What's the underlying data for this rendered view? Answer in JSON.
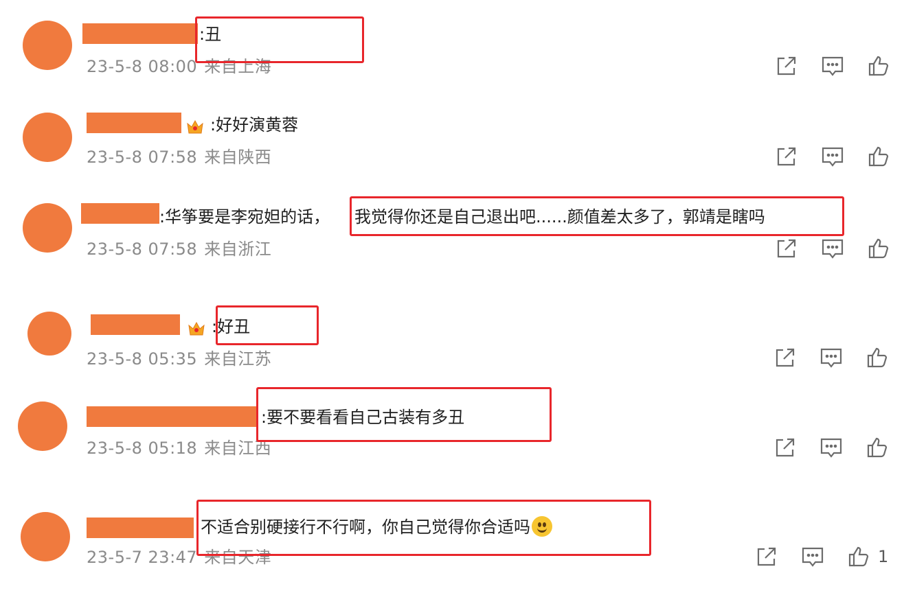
{
  "colors": {
    "avatar": "#f07a3e",
    "highlight_box": "#e8262b",
    "meta_text": "#8a8a8a",
    "content_text": "#1f1f1f",
    "icon_stroke": "#6b6b6b"
  },
  "comments": [
    {
      "text": ":丑",
      "time": "23-5-8 08:00",
      "location": "来自上海",
      "has_badge": false,
      "like_count": ""
    },
    {
      "text": ":好好演黄蓉",
      "time": "23-5-8 07:58",
      "location": "来自陕西",
      "has_badge": true,
      "badge_icon": "crown-badge-icon",
      "like_count": ""
    },
    {
      "text_prefix": ":华筝要是李宛妲的话，",
      "text": "我觉得你还是自己退出吧......颜值差太多了，郭靖是瞎吗",
      "time": "23-5-8 07:58",
      "location": "来自浙江",
      "has_badge": false,
      "like_count": ""
    },
    {
      "text": ":好丑",
      "time": "23-5-8 05:35",
      "location": "来自江苏",
      "has_badge": true,
      "badge_icon": "crown-badge-icon",
      "like_count": ""
    },
    {
      "text": ":要不要看看自己古装有多丑",
      "time": "23-5-8 05:18",
      "location": "来自江西",
      "has_badge": false,
      "like_count": ""
    },
    {
      "text": "不适合别硬接行不行啊，你自己觉得你合适吗",
      "emoji": "smile-emoji-icon",
      "time": "23-5-7 23:47",
      "location": "来自天津",
      "has_badge": false,
      "like_count": "1"
    }
  ],
  "actions": {
    "share_icon": "share-icon",
    "reply_icon": "comment-icon",
    "like_icon": "thumbs-up-icon"
  }
}
